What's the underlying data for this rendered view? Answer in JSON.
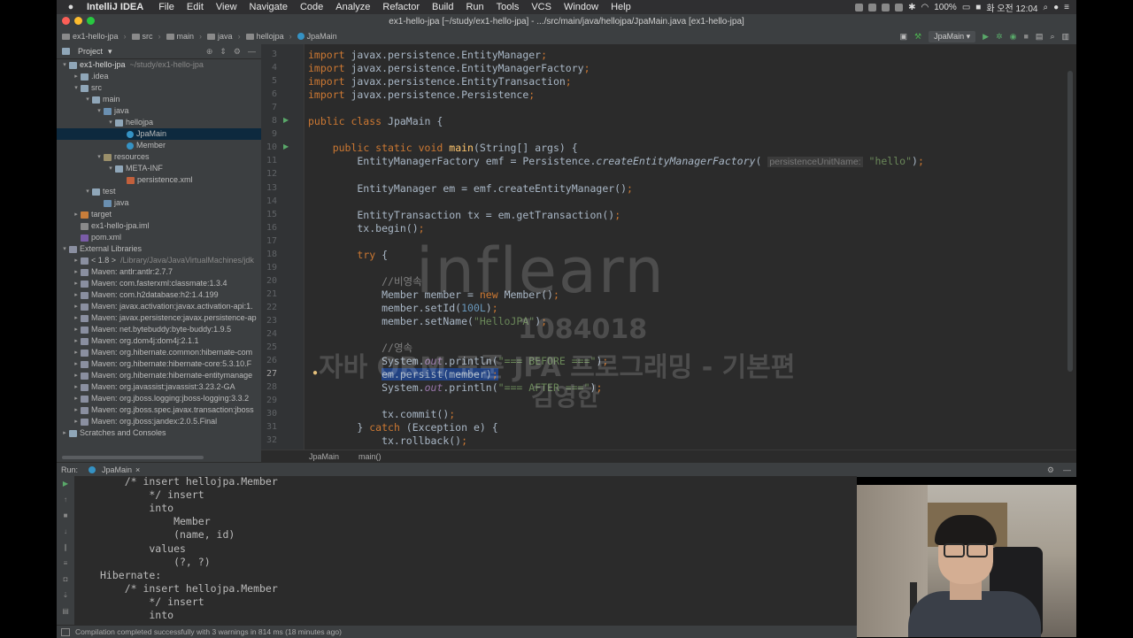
{
  "menubar": {
    "app": "IntelliJ IDEA",
    "items": [
      "File",
      "Edit",
      "View",
      "Navigate",
      "Code",
      "Analyze",
      "Refactor",
      "Build",
      "Run",
      "Tools",
      "VCS",
      "Window",
      "Help"
    ],
    "battery": "100%",
    "clock": "화 오전 12:04"
  },
  "window": {
    "title": "ex1-hello-jpa [~/study/ex1-hello-jpa] - .../src/main/java/hellojpa/JpaMain.java [ex1-hello-jpa]"
  },
  "breadcrumbs": [
    "ex1-hello-jpa",
    "src",
    "main",
    "java",
    "hellojpa",
    "JpaMain"
  ],
  "run_config": "JpaMain",
  "project": {
    "header": "Project",
    "tree": [
      {
        "indent": 0,
        "arrow": "▾",
        "icon": "fold",
        "label": "ex1-hello-jpa",
        "extra": "~/study/ex1-hello-jpa",
        "bold": true
      },
      {
        "indent": 1,
        "arrow": "▸",
        "icon": "fold",
        "label": ".idea"
      },
      {
        "indent": 1,
        "arrow": "▾",
        "icon": "fold",
        "label": "src"
      },
      {
        "indent": 2,
        "arrow": "▾",
        "icon": "fold",
        "label": "main"
      },
      {
        "indent": 3,
        "arrow": "▾",
        "icon": "src",
        "label": "java"
      },
      {
        "indent": 4,
        "arrow": "▾",
        "icon": "fold",
        "label": "hellojpa"
      },
      {
        "indent": 5,
        "arrow": "",
        "icon": "cls",
        "label": "JpaMain",
        "selected": true
      },
      {
        "indent": 5,
        "arrow": "",
        "icon": "cls",
        "label": "Member"
      },
      {
        "indent": 3,
        "arrow": "▾",
        "icon": "res",
        "label": "resources"
      },
      {
        "indent": 4,
        "arrow": "▾",
        "icon": "fold",
        "label": "META-INF"
      },
      {
        "indent": 5,
        "arrow": "",
        "icon": "xml",
        "label": "persistence.xml"
      },
      {
        "indent": 2,
        "arrow": "▾",
        "icon": "fold",
        "label": "test"
      },
      {
        "indent": 3,
        "arrow": "",
        "icon": "src",
        "label": "java"
      },
      {
        "indent": 1,
        "arrow": "▸",
        "icon": "target",
        "label": "target"
      },
      {
        "indent": 1,
        "arrow": "",
        "icon": "iml",
        "label": "ex1-hello-jpa.iml"
      },
      {
        "indent": 1,
        "arrow": "",
        "icon": "pom",
        "label": "pom.xml"
      },
      {
        "indent": 0,
        "arrow": "▾",
        "icon": "lib",
        "label": "External Libraries"
      },
      {
        "indent": 1,
        "arrow": "▸",
        "icon": "lib",
        "label": "< 1.8 >",
        "extra": "/Library/Java/JavaVirtualMachines/jdk"
      },
      {
        "indent": 1,
        "arrow": "▸",
        "icon": "lib",
        "label": "Maven: antlr:antlr:2.7.7"
      },
      {
        "indent": 1,
        "arrow": "▸",
        "icon": "lib",
        "label": "Maven: com.fasterxml:classmate:1.3.4"
      },
      {
        "indent": 1,
        "arrow": "▸",
        "icon": "lib",
        "label": "Maven: com.h2database:h2:1.4.199"
      },
      {
        "indent": 1,
        "arrow": "▸",
        "icon": "lib",
        "label": "Maven: javax.activation:javax.activation-api:1."
      },
      {
        "indent": 1,
        "arrow": "▸",
        "icon": "lib",
        "label": "Maven: javax.persistence:javax.persistence-ap"
      },
      {
        "indent": 1,
        "arrow": "▸",
        "icon": "lib",
        "label": "Maven: net.bytebuddy:byte-buddy:1.9.5"
      },
      {
        "indent": 1,
        "arrow": "▸",
        "icon": "lib",
        "label": "Maven: org.dom4j:dom4j:2.1.1"
      },
      {
        "indent": 1,
        "arrow": "▸",
        "icon": "lib",
        "label": "Maven: org.hibernate.common:hibernate-com"
      },
      {
        "indent": 1,
        "arrow": "▸",
        "icon": "lib",
        "label": "Maven: org.hibernate:hibernate-core:5.3.10.F"
      },
      {
        "indent": 1,
        "arrow": "▸",
        "icon": "lib",
        "label": "Maven: org.hibernate:hibernate-entitymanage"
      },
      {
        "indent": 1,
        "arrow": "▸",
        "icon": "lib",
        "label": "Maven: org.javassist:javassist:3.23.2-GA"
      },
      {
        "indent": 1,
        "arrow": "▸",
        "icon": "lib",
        "label": "Maven: org.jboss.logging:jboss-logging:3.3.2"
      },
      {
        "indent": 1,
        "arrow": "▸",
        "icon": "lib",
        "label": "Maven: org.jboss.spec.javax.transaction:jboss"
      },
      {
        "indent": 1,
        "arrow": "▸",
        "icon": "lib",
        "label": "Maven: org.jboss:jandex:2.0.5.Final"
      },
      {
        "indent": 0,
        "arrow": "▸",
        "icon": "fold",
        "label": "Scratches and Consoles"
      }
    ]
  },
  "editor": {
    "current_line": "27",
    "lines": [
      {
        "n": "3",
        "html": "<span class='kw'>import </span>javax.persistence.EntityManager<span class='kw'>;</span>"
      },
      {
        "n": "4",
        "html": "<span class='kw'>import </span>javax.persistence.EntityManagerFactory<span class='kw'>;</span>"
      },
      {
        "n": "5",
        "html": "<span class='kw'>import </span>javax.persistence.EntityTransaction<span class='kw'>;</span>"
      },
      {
        "n": "6",
        "html": "<span class='kw'>import </span>javax.persistence.Persistence<span class='kw'>;</span>"
      },
      {
        "n": "7",
        "html": ""
      },
      {
        "n": "8",
        "html": "<span class='kw'>public class </span>JpaMain {"
      },
      {
        "n": "9",
        "html": ""
      },
      {
        "n": "10",
        "html": "    <span class='kw'>public static void </span><span class='fn'>main</span>(String[] args) {"
      },
      {
        "n": "11",
        "html": "        EntityManagerFactory emf = Persistence.<span class='im'>createEntityManagerFactory</span>( <span class='hint'>persistenceUnitName:</span> <span class='st'>\"hello\"</span>)<span class='kw'>;</span>"
      },
      {
        "n": "12",
        "html": ""
      },
      {
        "n": "13",
        "html": "        EntityManager em = emf.createEntityManager()<span class='kw'>;</span>"
      },
      {
        "n": "14",
        "html": ""
      },
      {
        "n": "15",
        "html": "        EntityTransaction tx = em.getTransaction()<span class='kw'>;</span>"
      },
      {
        "n": "16",
        "html": "        tx.begin()<span class='kw'>;</span>"
      },
      {
        "n": "17",
        "html": ""
      },
      {
        "n": "18",
        "html": "        <span class='kw'>try </span>{"
      },
      {
        "n": "19",
        "html": ""
      },
      {
        "n": "20",
        "html": "            <span class='cm'>//비영속</span>"
      },
      {
        "n": "21",
        "html": "            Member member = <span class='kw'>new </span>Member()<span class='kw'>;</span>"
      },
      {
        "n": "22",
        "html": "            member.setId(<span class='nm'>100L</span>)<span class='kw'>;</span>"
      },
      {
        "n": "23",
        "html": "            member.setName(<span class='st'>\"HelloJPA\"</span>)<span class='kw'>;</span>"
      },
      {
        "n": "24",
        "html": ""
      },
      {
        "n": "25",
        "html": "            <span class='cm'>//영속</span>"
      },
      {
        "n": "26",
        "html": "            System.<span class='it'>out</span>.println(<span class='st'>\"=== BEFORE ===\"</span>)<span class='kw'>;</span>"
      },
      {
        "n": "27",
        "html": "            <span class='selbg'>em.persist(member)<span class='kw'>;</span></span>"
      },
      {
        "n": "28",
        "html": "            System.<span class='it'>out</span>.println(<span class='st'>\"=== AFTER ===\"</span>)<span class='kw'>;</span>"
      },
      {
        "n": "29",
        "html": ""
      },
      {
        "n": "30",
        "html": "            tx.commit()<span class='kw'>;</span>"
      },
      {
        "n": "31",
        "html": "        } <span class='kw'>catch </span>(Exception e) {"
      },
      {
        "n": "32",
        "html": "            tx.rollback()<span class='kw'>;</span>"
      }
    ],
    "breadcrumb": [
      "JpaMain",
      "main()"
    ]
  },
  "watermark": {
    "logo": "inflearn",
    "number": "1084018",
    "course": "자바 ORM 표준 JPA 프로그래밍 - 기본편",
    "name": "김영한"
  },
  "run": {
    "label": "Run:",
    "tab": "JpaMain",
    "console": [
      "    /* insert hellojpa.Member",
      "        */ insert",
      "        into",
      "            Member",
      "            (name, id)",
      "        values",
      "            (?, ?)",
      "Hibernate:",
      "    /* insert hellojpa.Member",
      "        */ insert",
      "        into"
    ]
  },
  "status": {
    "message": "Compilation completed successfully with 3 warnings in 814 ms (18 minutes ago)"
  },
  "colors": {
    "editor_bg": "#2b2b2b",
    "panel_bg": "#3c3f41",
    "keyword": "#cc7832",
    "string": "#6a8759",
    "number": "#6897bb",
    "selection": "#214283"
  }
}
